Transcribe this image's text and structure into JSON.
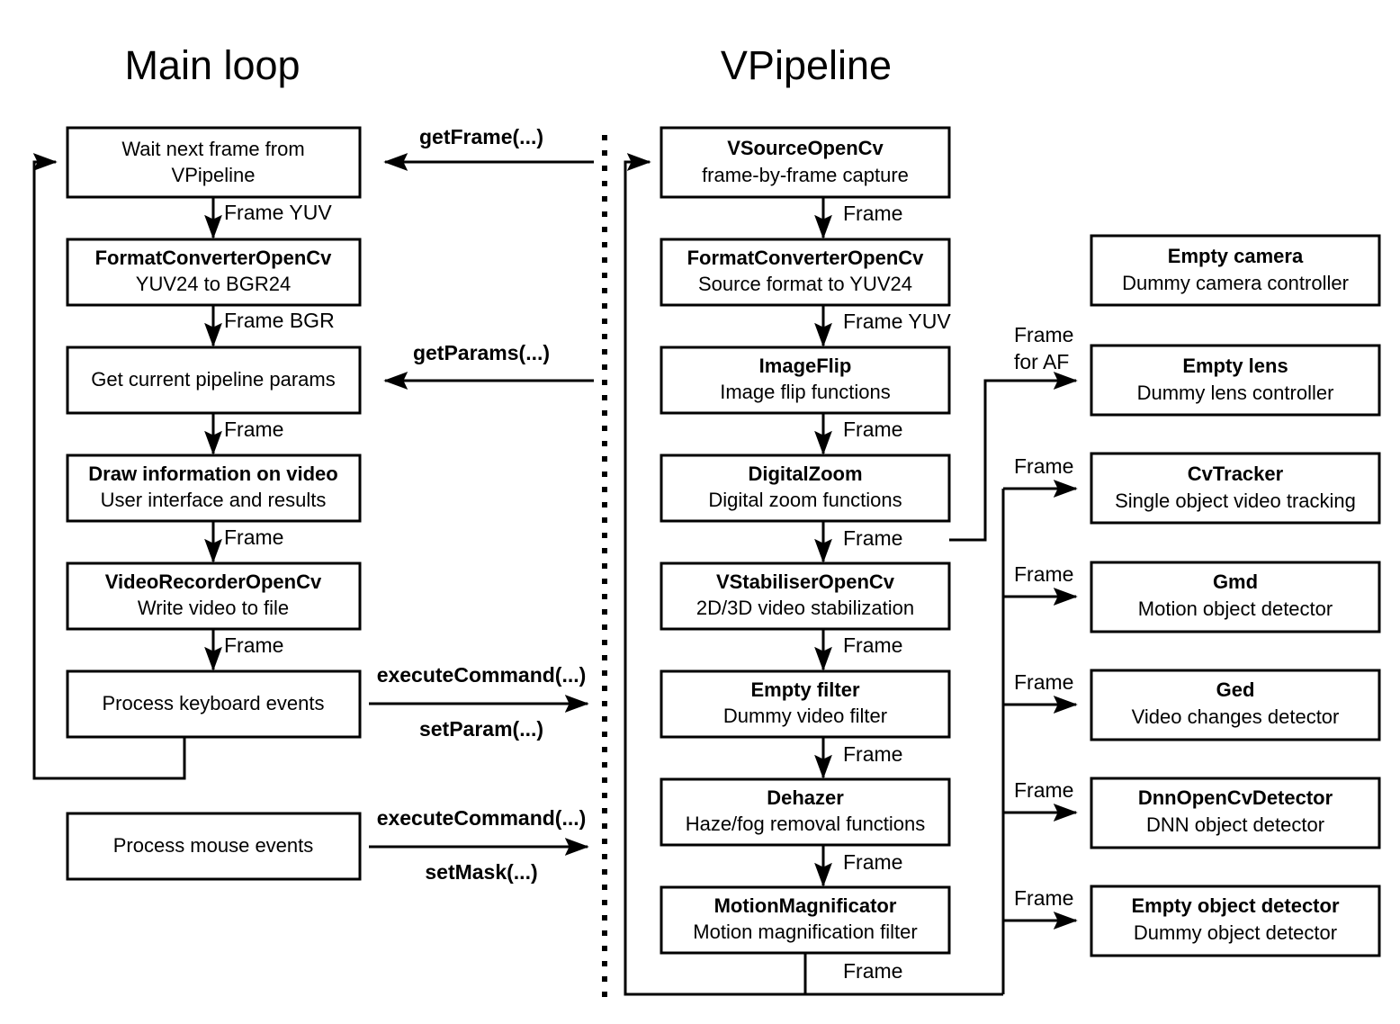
{
  "columns": {
    "left_title": "Main loop",
    "right_title": "VPipeline"
  },
  "main_loop": {
    "boxes": [
      {
        "title": "",
        "sub": "Wait next frame from",
        "sub2": "VPipeline",
        "bold_title": false
      },
      {
        "title": "FormatConverterOpenCv",
        "sub": "YUV24 to BGR24",
        "bold_title": true
      },
      {
        "title": "",
        "sub": "Get current pipeline params",
        "bold_title": false
      },
      {
        "title": "Draw information on video",
        "sub": "User interface and results",
        "bold_title": true
      },
      {
        "title": "VideoRecorderOpenCv",
        "sub": "Write video to file",
        "bold_title": true
      },
      {
        "title": "",
        "sub": "Process keyboard events",
        "bold_title": false
      },
      {
        "title": "",
        "sub": "Process mouse events",
        "bold_title": false
      }
    ],
    "edge_labels": [
      "Frame YUV",
      "Frame BGR",
      "Frame",
      "Frame",
      "Frame"
    ]
  },
  "api_calls": [
    {
      "label": "getFrame(...)",
      "direction": "left"
    },
    {
      "label": "getParams(...)",
      "direction": "left"
    },
    {
      "label": "executeCommand(...)",
      "direction": "right"
    },
    {
      "label": "setParam(...)",
      "direction": "right"
    },
    {
      "label": "executeCommand(...)",
      "direction": "right"
    },
    {
      "label": "setMask(...)",
      "direction": "right"
    }
  ],
  "pipeline": {
    "boxes": [
      {
        "title": "VSourceOpenCv",
        "sub": "frame-by-frame capture"
      },
      {
        "title": "FormatConverterOpenCv",
        "sub": "Source format to YUV24"
      },
      {
        "title": "ImageFlip",
        "sub": "Image flip functions"
      },
      {
        "title": "DigitalZoom",
        "sub": "Digital zoom functions"
      },
      {
        "title": "VStabiliserOpenCv",
        "sub": "2D/3D video stabilization"
      },
      {
        "title": "Empty filter",
        "sub": "Dummy video filter"
      },
      {
        "title": "Dehazer",
        "sub": "Haze/fog removal functions"
      },
      {
        "title": "MotionMagnificator",
        "sub": "Motion magnification filter"
      }
    ],
    "edge_labels": [
      "Frame",
      "Frame YUV",
      "Frame",
      "Frame",
      "Frame",
      "Frame",
      "Frame",
      "Frame"
    ]
  },
  "modules": [
    {
      "title": "Empty camera",
      "sub": "Dummy camera controller",
      "in_label": "",
      "in_label2": ""
    },
    {
      "title": "Empty lens",
      "sub": "Dummy lens controller",
      "in_label": "Frame",
      "in_label2": "for AF"
    },
    {
      "title": "CvTracker",
      "sub": "Single object video tracking",
      "in_label": "Frame",
      "in_label2": ""
    },
    {
      "title": "Gmd",
      "sub": "Motion object detector",
      "in_label": "Frame",
      "in_label2": ""
    },
    {
      "title": "Ged",
      "sub": "Video changes detector",
      "in_label": "Frame",
      "in_label2": ""
    },
    {
      "title": "DnnOpenCvDetector",
      "sub": "DNN object detector",
      "in_label": "Frame",
      "in_label2": ""
    },
    {
      "title": "Empty object detector",
      "sub": "Dummy object detector",
      "in_label": "Frame",
      "in_label2": ""
    }
  ],
  "colors": {
    "stroke": "#000000",
    "fill": "#ffffff",
    "text": "#000000"
  }
}
